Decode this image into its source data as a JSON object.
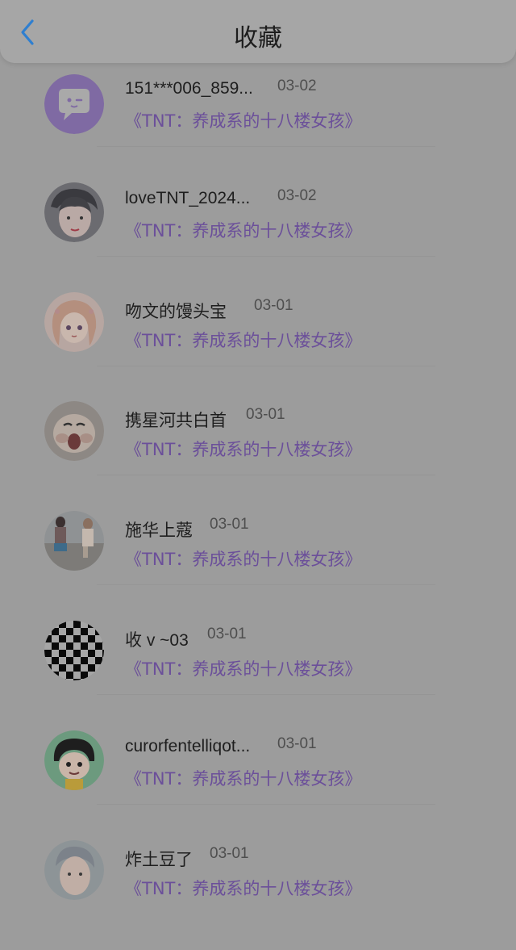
{
  "header": {
    "title": "收藏",
    "back_icon": "chevron-left-icon",
    "accent": "#2f7fd0"
  },
  "book_color": "#6b4f9a",
  "items": [
    {
      "name": "151***006_859...",
      "date": "03-02",
      "book": "《TNT：养成系的十八楼女孩》",
      "avatar": "chat-bubble-avatar"
    },
    {
      "name": "loveTNT_2024...",
      "date": "03-02",
      "book": "《TNT：养成系的十八楼女孩》",
      "avatar": "portrait-avatar"
    },
    {
      "name": "吻文的馒头宝",
      "date": "03-01",
      "book": "《TNT：养成系的十八楼女孩》",
      "avatar": "anime-girl-avatar"
    },
    {
      "name": "携星河共白首",
      "date": "03-01",
      "book": "《TNT：养成系的十八楼女孩》",
      "avatar": "cartoon-face-avatar"
    },
    {
      "name": "施华上蔻",
      "date": "03-01",
      "book": "《TNT：养成系的十八楼女孩》",
      "avatar": "photo-avatar"
    },
    {
      "name": "收 v ~03",
      "date": "03-01",
      "book": "《TNT：养成系的十八楼女孩》",
      "avatar": "checkerboard-avatar"
    },
    {
      "name": "curorfentelliqot...",
      "date": "03-01",
      "book": "《TNT：养成系的十八楼女孩》",
      "avatar": "cartoon-girl-avatar"
    },
    {
      "name": "炸土豆了",
      "date": "03-01",
      "book": "《TNT：养成系的十八楼女孩》",
      "avatar": "portrait-avatar-2"
    }
  ]
}
